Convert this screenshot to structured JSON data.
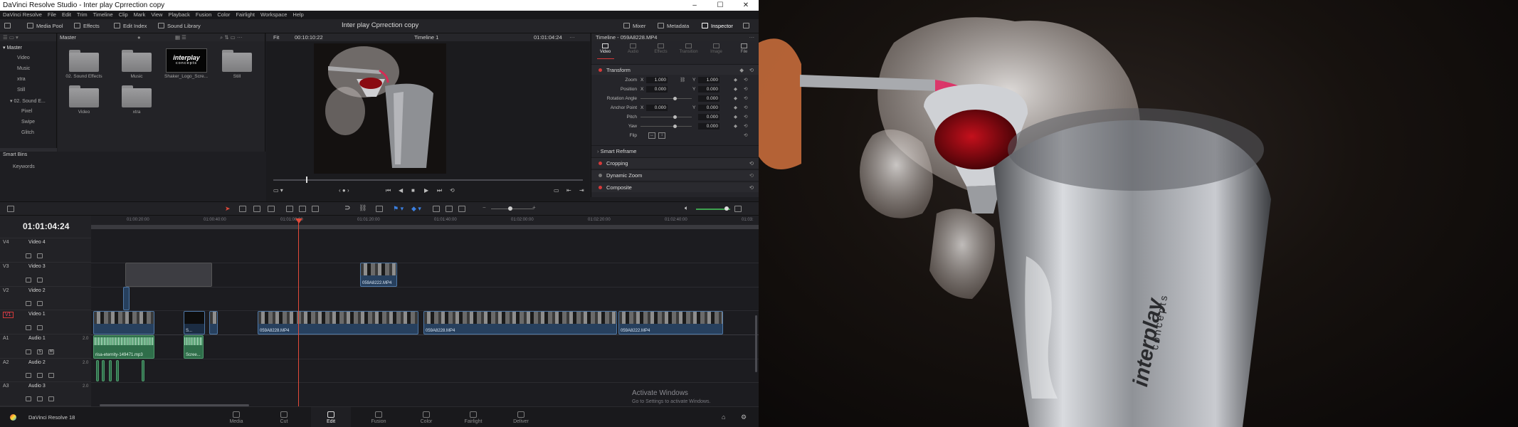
{
  "app": {
    "window_title": "DaVinci Resolve Studio - Inter play Cprrection copy",
    "project_title": "Inter play Cprrection copy",
    "window_controls": [
      "–",
      "☐",
      "✕"
    ]
  },
  "menu": [
    "DaVinci Resolve",
    "File",
    "Edit",
    "Trim",
    "Timeline",
    "Clip",
    "Mark",
    "View",
    "Playback",
    "Fusion",
    "Color",
    "Fairlight",
    "Workspace",
    "Help"
  ],
  "toolbar": {
    "media_pool": "Media Pool",
    "effects": "Effects",
    "edit_index": "Edit Index",
    "sound_library": "Sound Library",
    "mixer": "Mixer",
    "metadata": "Metadata",
    "inspector": "Inspector"
  },
  "bins": {
    "header": "Master",
    "items": [
      "Master",
      "Video",
      "Music",
      "xtra",
      "Still",
      "02. Sound E...",
      "Pixel",
      "Swipe",
      "Glitch"
    ],
    "smart_bins": "Smart Bins",
    "keywords": "Keywords"
  },
  "media_pool": {
    "header": "Master",
    "clips": [
      "02. Sound Effects",
      "Music",
      "Shaker_Logo_Scre...",
      "Still",
      "Video",
      "xtra"
    ],
    "logo_text": "interplay",
    "logo_sub": "concepts"
  },
  "viewer": {
    "fit": "Fit",
    "source_tc": "00:10:10:22",
    "timeline_name": "Timeline 1",
    "record_tc": "01:01:04:24"
  },
  "inspector": {
    "title": "Timeline - 059A8228.MP4",
    "tabs": [
      "Video",
      "Audio",
      "Effects",
      "Transition",
      "Image",
      "File"
    ],
    "transform_label": "Transform",
    "rows": [
      {
        "label": "Zoom",
        "x": "1.000",
        "y": "1.000"
      },
      {
        "label": "Position",
        "x": "0.000",
        "y": "0.000"
      },
      {
        "label": "Rotation Angle",
        "v": "0.000"
      },
      {
        "label": "Anchor Point",
        "x": "0.000",
        "y": "0.000"
      },
      {
        "label": "Pitch",
        "v": "0.000"
      },
      {
        "label": "Yaw",
        "v": "0.000"
      },
      {
        "label": "Flip",
        "v": ""
      }
    ],
    "sections": [
      "Smart Reframe",
      "Cropping",
      "Dynamic Zoom",
      "Composite"
    ]
  },
  "timeline": {
    "timecode": "01:01:04:24",
    "ruler": [
      "01:00:20:00",
      "01:00:40:00",
      "01:01:00:00",
      "01:01:20:00",
      "01:01:40:00",
      "01:02:00:00",
      "01:02:20:00",
      "01:02:40:00",
      "01:03:"
    ],
    "tracks": [
      {
        "id": "V4",
        "name": "Video 4"
      },
      {
        "id": "V3",
        "name": "Video 3"
      },
      {
        "id": "V2",
        "name": "Video 2"
      },
      {
        "id": "V1",
        "name": "Video 1"
      },
      {
        "id": "A1",
        "name": "Audio 1",
        "ch": "2.0"
      },
      {
        "id": "A2",
        "name": "Audio 2",
        "ch": "2.0"
      },
      {
        "id": "A3",
        "name": "Audio 3",
        "ch": "2.0"
      }
    ],
    "clips": {
      "v3_clip": "059A8222.MP4",
      "v1_a": "059A8228.MP4",
      "v1_b": "059A8228.MP4",
      "v1_c": "059A8222.MP4",
      "v1_logo": "S...",
      "a1_a": "risa-eternity-149471.mp3",
      "a1_b": "Scree..."
    }
  },
  "watermark": {
    "line1": "Activate Windows",
    "line2": "Go to Settings to activate Windows."
  },
  "pages": [
    "Media",
    "Cut",
    "Edit",
    "Fusion",
    "Color",
    "Fairlight",
    "Deliver"
  ],
  "active_page": "Edit",
  "status": {
    "version": "DaVinci Resolve 18"
  },
  "photo": {
    "shaker_brand": "interplay",
    "shaker_sub": "concepts"
  },
  "colors": {
    "accent": "#d63a3a",
    "video_clip": "#27405e",
    "audio_clip": "#2f6e4a",
    "playhead": "#e34a3a"
  }
}
